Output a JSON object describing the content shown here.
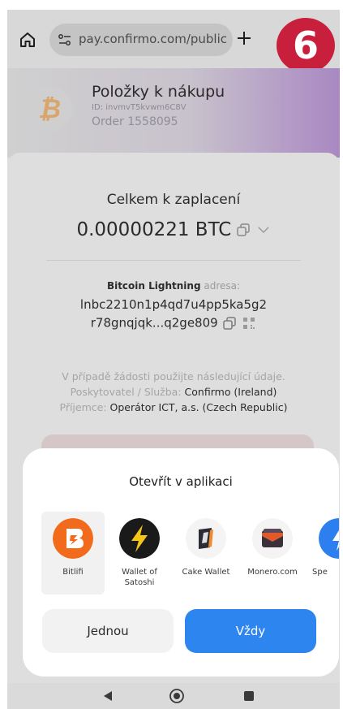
{
  "browser": {
    "url": "pay.confirmo.com/public",
    "step_number": "6"
  },
  "header": {
    "title": "Položky k nákupu",
    "id_line": "ID: invmvT5kvwm6C8V",
    "order_line": "Order 1558095",
    "logo_glyph": "₿"
  },
  "payment": {
    "total_label": "Celkem k zaplacení",
    "amount": "0.00000221 BTC",
    "address_label_bold": "Bitcoin Lightning",
    "address_label_muted": "adresa:",
    "address_line1": "lnbc2210n1p4qd7u4pp5ka5g2",
    "address_line2": "r78gnqjqk...q2ge809",
    "note": "V případě žádosti použijte následující údaje.",
    "provider_label": "Poskytovatel / Služba:",
    "provider_value": "Confirmo (Ireland)",
    "recipient_label": "Příjemce:",
    "recipient_value": "Operátor ICT, a.s. (Czech Republic)"
  },
  "sheet": {
    "title": "Otevřít v aplikaci",
    "apps": [
      {
        "label": "Bitlifi",
        "icon": "bitlifi-icon"
      },
      {
        "label": "Wallet of\nSatoshi",
        "icon": "lightning-bolt-icon"
      },
      {
        "label": "Cake Wallet",
        "icon": "cake-wallet-icon"
      },
      {
        "label": "Monero.com",
        "icon": "wallet-icon"
      },
      {
        "label": "Spe",
        "icon": "speed-icon"
      }
    ],
    "once_label": "Jednou",
    "always_label": "Vždy"
  },
  "colors": {
    "badge": "#c8203c",
    "primary_button": "#2d86ef",
    "bitlifi": "#f26a1b"
  }
}
